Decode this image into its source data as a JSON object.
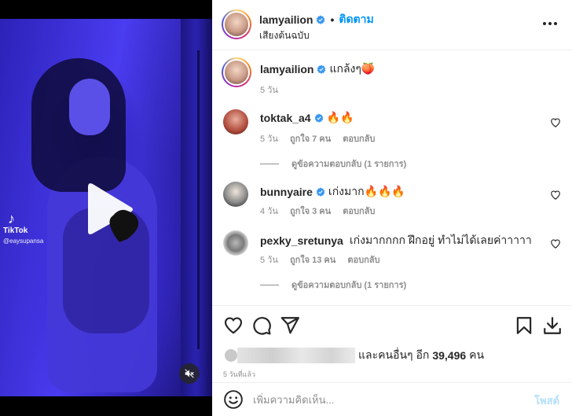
{
  "media": {
    "watermark": {
      "brand": "TikTok",
      "handle": "@eaysupansa"
    },
    "play_icon": "play-icon",
    "mute_icon": "speaker-muted-icon"
  },
  "header": {
    "username": "lamyailion",
    "verified": true,
    "separator": "•",
    "follow_label": "ติดตาม",
    "audio_label": "เสียงต้นฉบับ",
    "more_icon": "more-horizontal-icon"
  },
  "caption": {
    "username": "lamyailion",
    "text": "แกล้งๆ🍑",
    "time": "5 วัน"
  },
  "comments": [
    {
      "username": "toktak_a4",
      "verified": true,
      "text": "🔥🔥",
      "time": "5 วัน",
      "likes": "ถูกใจ 7 คน",
      "reply_label": "ตอบกลับ",
      "view_replies": "ดูข้อความตอบกลับ (1 รายการ)"
    },
    {
      "username": "bunnyaire",
      "verified": true,
      "text": "เก่งมาก🔥🔥🔥",
      "time": "4 วัน",
      "likes": "ถูกใจ 3 คน",
      "reply_label": "ตอบกลับ",
      "view_replies": ""
    },
    {
      "username": "pexky_sretunya",
      "verified": false,
      "text": "เก่งมากกกก ฝึกอยู่ ทำไม่ได้เลยค่าาาาา",
      "time": "5 วัน",
      "likes": "ถูกใจ 13 คน",
      "reply_label": "ตอบกลับ",
      "view_replies": "ดูข้อความตอบกลับ (1 รายการ)"
    }
  ],
  "actions": {
    "like_icon": "heart-icon",
    "comment_icon": "comment-icon",
    "share_icon": "send-icon",
    "save_icon": "bookmark-icon",
    "download_icon": "download-icon"
  },
  "likes": {
    "prefix": "และคนอื่นๆ อีก",
    "count": "39,496",
    "suffix": "คน"
  },
  "timestamp": "5 วันที่แล้ว",
  "composer": {
    "placeholder": "เพิ่มความคิดเห็น...",
    "post_label": "โพสต์",
    "emoji_icon": "emoji-icon"
  },
  "colors": {
    "accent": "#0095f6",
    "verified": "#3897f0",
    "post_disabled": "#b2dffc",
    "secondary_text": "#8e8e8e",
    "video_tint": "#3a2dd6"
  }
}
